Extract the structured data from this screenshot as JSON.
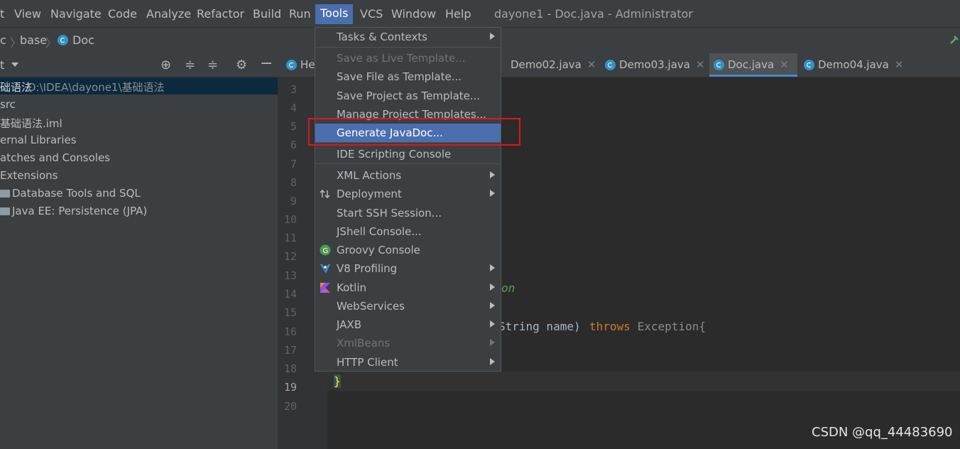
{
  "menubar": {
    "items": [
      "t",
      "View",
      "Navigate",
      "Code",
      "Analyze",
      "Refactor",
      "Build",
      "Run",
      "Tools",
      "VCS",
      "Window",
      "Help"
    ],
    "window_title": "dayone1 - Doc.java - Administrator"
  },
  "breadcrumb": {
    "items": [
      "c",
      "base",
      "Doc"
    ]
  },
  "project_panel": {
    "title": "t",
    "tree": [
      {
        "label": "础语法",
        "path": "D:\\IDEA\\dayone1\\基础语法"
      },
      {
        "label": "src"
      },
      {
        "label": "基础语法.iml"
      },
      {
        "label": "ernal Libraries"
      },
      {
        "label": "atches and Consoles"
      },
      {
        "label": "Extensions"
      },
      {
        "label": "Database Tools and SQL"
      },
      {
        "label": "Java EE: Persistence (JPA)"
      }
    ]
  },
  "tabs": [
    {
      "label": "He"
    },
    {
      "label": "Demo02.java"
    },
    {
      "label": "Demo03.java"
    },
    {
      "label": "Doc.java",
      "active": true
    },
    {
      "label": "Demo04.java"
    }
  ],
  "gutter": {
    "line_numbers": [
      "3",
      "4",
      "5",
      "6",
      "7",
      "8",
      "9",
      "10",
      "11",
      "12",
      "13",
      "14",
      "15",
      "16",
      "17",
      "18",
      "19",
      "20"
    ]
  },
  "code": {
    "line14_fragment": "on",
    "line16_fragment_a": "String name) ",
    "line16_keyword": "throws",
    "line16_fragment_b": " Exception{",
    "line19_brace": "}"
  },
  "tools_menu": {
    "items": [
      {
        "label": "Tasks & Contexts",
        "submenu": true
      },
      {
        "label": "Save as Live Template...",
        "disabled": true
      },
      {
        "label": "Save File as Template..."
      },
      {
        "label": "Save Project as Template..."
      },
      {
        "label": "Manage Project Templates..."
      },
      {
        "label": "Generate JavaDoc...",
        "highlighted": true
      },
      {
        "label": "IDE Scripting Console"
      },
      {
        "label": "XML Actions",
        "submenu": true
      },
      {
        "label": "Deployment",
        "submenu": true,
        "icon": "deployment-icon"
      },
      {
        "label": "Start SSH Session..."
      },
      {
        "label": "JShell Console..."
      },
      {
        "label": "Groovy Console",
        "icon": "groovy-icon"
      },
      {
        "label": "V8 Profiling",
        "submenu": true,
        "icon": "v8-icon"
      },
      {
        "label": "Kotlin",
        "submenu": true,
        "icon": "kotlin-icon"
      },
      {
        "label": "WebServices",
        "submenu": true
      },
      {
        "label": "JAXB",
        "submenu": true
      },
      {
        "label": "XmlBeans",
        "submenu": true,
        "disabled": true
      },
      {
        "label": "HTTP Client",
        "submenu": true
      }
    ]
  },
  "watermark": "CSDN @qq_44483690",
  "colors": {
    "accent": "#4b6eaf",
    "highlight_box": "#e0161b",
    "keyword": "#cc7832",
    "brace": "#ffef28"
  }
}
